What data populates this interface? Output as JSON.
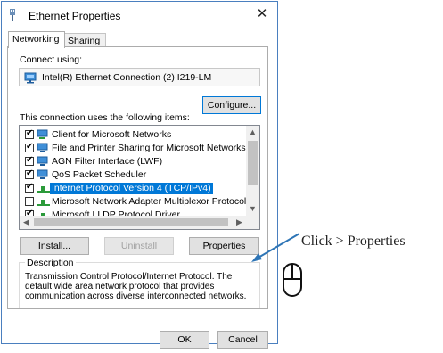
{
  "window": {
    "title": "Ethernet Properties",
    "close_glyph": "✕"
  },
  "tabs": [
    {
      "label": "Networking",
      "active": true
    },
    {
      "label": "Sharing",
      "active": false
    }
  ],
  "connect_using": {
    "label": "Connect using:",
    "adapter_name": "Intel(R) Ethernet Connection (2) I219-LM"
  },
  "buttons": {
    "configure": "Configure...",
    "install": "Install...",
    "uninstall": "Uninstall",
    "properties": "Properties",
    "ok": "OK",
    "cancel": "Cancel"
  },
  "items_label": "This connection uses the following items:",
  "items": [
    {
      "label": "Client for Microsoft Networks",
      "checked": true,
      "icon": "network-client-icon",
      "selected": false
    },
    {
      "label": "File and Printer Sharing for Microsoft Networks",
      "checked": true,
      "icon": "network-service-icon",
      "selected": false
    },
    {
      "label": "AGN Filter Interface (LWF)",
      "checked": true,
      "icon": "network-service-icon",
      "selected": false
    },
    {
      "label": "QoS Packet Scheduler",
      "checked": true,
      "icon": "network-service-icon",
      "selected": false
    },
    {
      "label": "Internet Protocol Version 4 (TCP/IPv4)",
      "checked": true,
      "icon": "network-protocol-icon",
      "selected": true
    },
    {
      "label": "Microsoft Network Adapter Multiplexor Protocol",
      "checked": false,
      "icon": "network-protocol-icon",
      "selected": false
    },
    {
      "label": "Microsoft LLDP Protocol Driver",
      "checked": true,
      "icon": "network-protocol-icon",
      "selected": false
    }
  ],
  "description": {
    "legend": "Description",
    "text": "Transmission Control Protocol/Internet Protocol. The default wide area network protocol that provides communication across diverse interconnected networks."
  },
  "annotation": {
    "text": "Click > Properties",
    "icon": "mouse-left-click-icon",
    "accent_color": "#2e75b6"
  }
}
